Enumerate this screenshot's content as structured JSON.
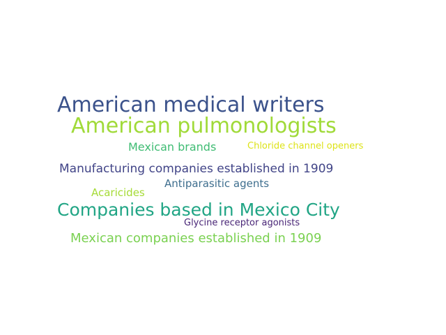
{
  "words": [
    {
      "text": "American medical writers",
      "color": "#3b528b"
    },
    {
      "text": "American pulmonologists",
      "color": "#a0da39"
    },
    {
      "text": "Mexican brands",
      "color": "#3fbc73"
    },
    {
      "text": "Chloride channel openers",
      "color": "#dde318"
    },
    {
      "text": "Manufacturing companies established in 1909",
      "color": "#414487"
    },
    {
      "text": "Antiparasitic agents",
      "color": "#3e6e8e"
    },
    {
      "text": "Acaricides",
      "color": "#a5db36"
    },
    {
      "text": "Companies based in Mexico City",
      "color": "#21a585"
    },
    {
      "text": "Glycine receptor agonists",
      "color": "#482576"
    },
    {
      "text": "Mexican companies established in 1909",
      "color": "#7ad151"
    }
  ]
}
